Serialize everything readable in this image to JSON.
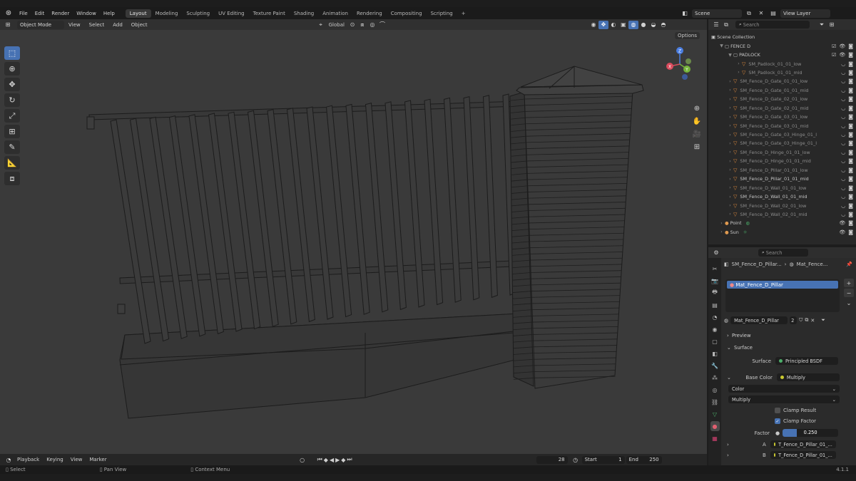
{
  "menu": {
    "items": [
      "File",
      "Edit",
      "Render",
      "Window",
      "Help"
    ]
  },
  "workspaces": [
    "Layout",
    "Modeling",
    "Sculpting",
    "UV Editing",
    "Texture Paint",
    "Shading",
    "Animation",
    "Rendering",
    "Compositing",
    "Scripting"
  ],
  "active_workspace": "Layout",
  "scene": {
    "name": "Scene",
    "view_layer": "View Layer"
  },
  "viewport": {
    "mode": "Object Mode",
    "menu": [
      "View",
      "Select",
      "Add",
      "Object"
    ],
    "orientation": "Global",
    "options_label": "Options"
  },
  "gizmo": {
    "x": "X",
    "y": "Y",
    "z": "Z"
  },
  "outliner": {
    "search_placeholder": "Search",
    "root": "Scene Collection",
    "collection": "FENCE D",
    "subcollection": "PADLOCK",
    "rows": [
      {
        "name": "SM_Padlock_01_01_low",
        "dim": true
      },
      {
        "name": "SM_Padlock_01_01_mid",
        "dim": true
      },
      {
        "name": "SM_Fence_D_Gate_01_01_low",
        "dim": true
      },
      {
        "name": "SM_Fence_D_Gate_01_01_mid",
        "dim": true
      },
      {
        "name": "SM_Fence_D_Gate_02_01_low",
        "dim": true
      },
      {
        "name": "SM_Fence_D_Gate_02_01_mid",
        "dim": true
      },
      {
        "name": "SM_Fence_D_Gate_03_01_low",
        "dim": true
      },
      {
        "name": "SM_Fence_D_Gate_03_01_mid",
        "dim": true
      },
      {
        "name": "SM_Fence_D_Gate_03_Hinge_01_l",
        "dim": true
      },
      {
        "name": "SM_Fence_D_Gate_03_Hinge_01_l",
        "dim": true
      },
      {
        "name": "SM_Fence_D_Hinge_01_01_low",
        "dim": true
      },
      {
        "name": "SM_Fence_D_Hinge_01_01_mid",
        "dim": true
      },
      {
        "name": "SM_Fence_D_Pillar_01_01_low",
        "dim": true
      },
      {
        "name": "SM_Fence_D_Pillar_01_01_mid",
        "dim": false
      },
      {
        "name": "SM_Fence_D_Wall_01_01_low",
        "dim": true
      },
      {
        "name": "SM_Fence_D_Wall_01_01_mid",
        "dim": false
      },
      {
        "name": "SM_Fence_D_Wall_02_01_low",
        "dim": true
      },
      {
        "name": "SM_Fence_D_Wall_02_01_mid",
        "dim": true
      }
    ],
    "lights": [
      "Point",
      "Sun"
    ]
  },
  "properties": {
    "search_placeholder": "Search",
    "breadcrumb_object": "SM_Fence_D_Pillar...",
    "breadcrumb_material": "Mat_Fence...",
    "slot": "Mat_Fence_D_Pillar",
    "material_name": "Mat_Fence_D_Pillar",
    "users": "2",
    "preview_label": "Preview",
    "surface_section": "Surface",
    "surface_label": "Surface",
    "surface_value": "Principled BSDF",
    "base_color_label": "Base Color",
    "base_color_value": "Multiply",
    "color_dropdown": "Color",
    "blend_dropdown": "Multiply",
    "clamp_result": "Clamp Result",
    "clamp_factor": "Clamp Factor",
    "clamp_result_checked": false,
    "clamp_factor_checked": true,
    "factor_label": "Factor",
    "factor_value": "0.250",
    "factor_fraction": 0.25,
    "a_label": "A",
    "a_value": "T_Fence_D_Pillar_01_...",
    "b_label": "B",
    "b_value": "T_Fence_D_Pillar_01_..."
  },
  "timeline": {
    "menu": [
      "Playback",
      "Keying",
      "View",
      "Marker"
    ],
    "current_frame": "28",
    "start_label": "Start",
    "start": "1",
    "end_label": "End",
    "end": "250"
  },
  "status": {
    "select": "Select",
    "pan": "Pan View",
    "context": "Context Menu",
    "version": "4.1.1"
  },
  "colors": {
    "accent": "#4772b3",
    "mesh_tri": "#e08a3c",
    "background": "#3a3a3a"
  }
}
